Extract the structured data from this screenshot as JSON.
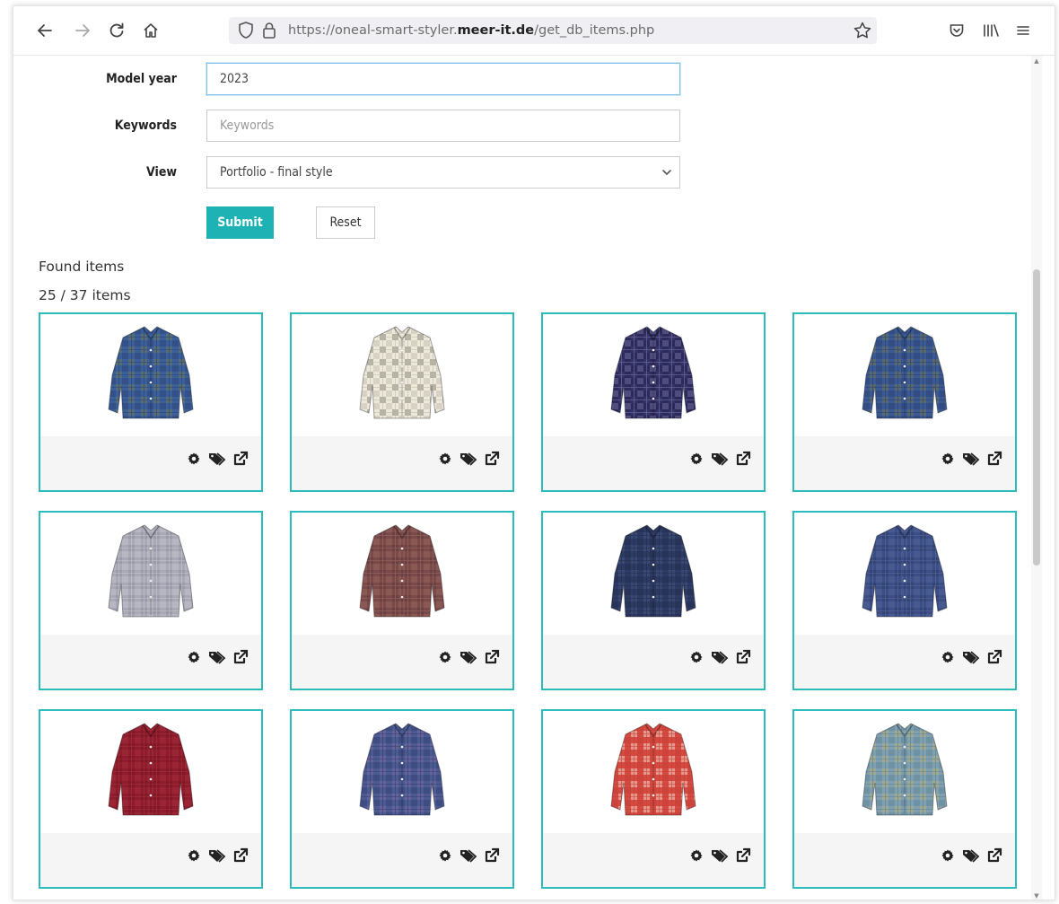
{
  "browser": {
    "url_prefix": "https://oneal-smart-styler.",
    "url_domain": "meer-it.de",
    "url_path": "/get_db_items.php"
  },
  "form": {
    "model_year_label": "Model year",
    "model_year_value": "2023",
    "keywords_label": "Keywords",
    "keywords_placeholder": "Keywords",
    "view_label": "View",
    "view_selected": "Portfolio - final style",
    "submit_label": "Submit",
    "reset_label": "Reset"
  },
  "results": {
    "found_label": "Found items",
    "count_text": "25 / 37 items"
  },
  "items": [
    {
      "colors": [
        "#3a5f9a",
        "#6f7a55",
        "#2c3f70"
      ]
    },
    {
      "colors": [
        "#ece8dc",
        "#8a8475",
        "#bfb9a6"
      ]
    },
    {
      "colors": [
        "#2b2a5a",
        "#3b3a72",
        "#7a78a8"
      ]
    },
    {
      "colors": [
        "#3b5a94",
        "#6e7750",
        "#2b3c6c"
      ]
    },
    {
      "colors": [
        "#a9a9b6",
        "#8d8d9c",
        "#c9c9d2"
      ]
    },
    {
      "colors": [
        "#7a4a4a",
        "#5e3a40",
        "#a06a60"
      ]
    },
    {
      "colors": [
        "#2d3b64",
        "#45547e",
        "#1f2a48"
      ]
    },
    {
      "colors": [
        "#3b4f86",
        "#2c3a68",
        "#58689a"
      ]
    },
    {
      "colors": [
        "#8e1c2c",
        "#75141f",
        "#a83040"
      ]
    },
    {
      "colors": [
        "#4c5a92",
        "#7a6aa0",
        "#2f3b6e"
      ]
    },
    {
      "colors": [
        "#d44a40",
        "#f1d7c8",
        "#c23a32"
      ]
    },
    {
      "colors": [
        "#7fa0b0",
        "#b9b077",
        "#5b7e91"
      ]
    }
  ],
  "card_actions": {
    "settings": "gear-icon",
    "tags": "tags-icon",
    "open": "external-link-icon"
  }
}
